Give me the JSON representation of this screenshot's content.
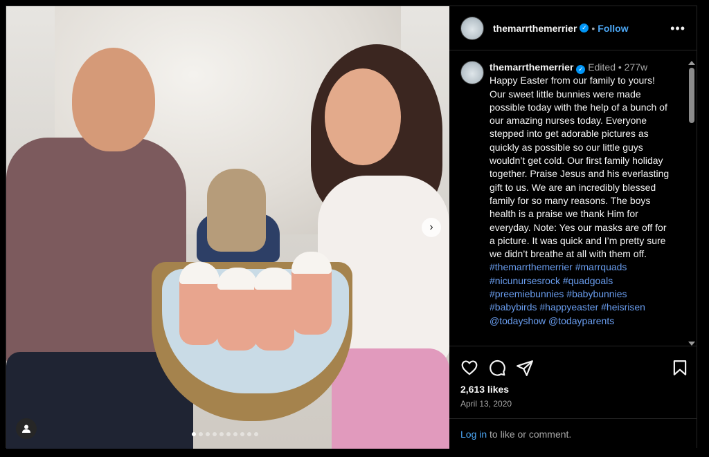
{
  "header": {
    "username": "themarrthemerrier",
    "follow_label": "Follow",
    "separator": "•"
  },
  "caption": {
    "username": "themarrthemerrier",
    "edited_label": "Edited",
    "separator": "•",
    "age": "277w",
    "text": "Happy Easter from our family to yours! Our sweet little bunnies were made possible today with the help of a bunch of our amazing nurses today. Everyone stepped into get adorable pictures as quickly as possible so our little guys wouldn’t get cold. Our first family holiday together. Praise Jesus and his everlasting gift to us. We are an incredibly blessed family for so many reasons. The boys health is a praise we thank Him for everyday.  Note: Yes our masks are off for a picture. It was quick and I’m pretty sure we didn’t breathe at all with them off. ",
    "hashtags": [
      "#themarrthemerrier",
      "#marrquads",
      "#nicunursesrock",
      "#quadgoals",
      "#preemiebunnies",
      "#babybunnies",
      "#babybirds",
      "#happyeaster",
      "#heisrisen",
      "@todayshow",
      "@todayparents"
    ]
  },
  "post": {
    "likes": "2,613 likes",
    "date": "April 13, 2020",
    "carousel_count": 10,
    "carousel_active_index": 0
  },
  "login": {
    "link_label": "Log in",
    "rest": " to like or comment."
  },
  "icons": {
    "like": "heart-icon",
    "comment": "comment-icon",
    "share": "paper-plane-icon",
    "save": "bookmark-icon",
    "more": "more-horizontal-icon",
    "verified": "verified-badge-icon",
    "next": "chevron-right-icon",
    "tags": "user-tag-icon"
  },
  "colors": {
    "link": "#4ca7f5",
    "hashtag": "#6a9ef0",
    "verified": "#0095f6",
    "muted": "#a8a8a8"
  }
}
